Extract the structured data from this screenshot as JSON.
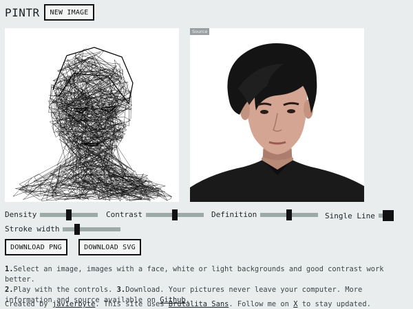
{
  "header": {
    "brand": "PINTR",
    "new_image_label": "NEW IMAGE"
  },
  "source_panel": {
    "badge": "Source"
  },
  "controls": {
    "density": {
      "label": "Density",
      "value": 0.5
    },
    "contrast": {
      "label": "Contrast",
      "value": 0.5
    },
    "definition": {
      "label": "Definition",
      "value": 0.5
    },
    "single_line": {
      "label": "Single Line",
      "checked": true
    },
    "stroke_width": {
      "label": "Stroke width",
      "value": 0.25
    }
  },
  "buttons": {
    "download_png": "DOWNLOAD PNG",
    "download_svg": "DOWNLOAD SVG"
  },
  "instructions": {
    "step1_num": "1.",
    "step1_text": "Select an image, images with a face, white or light backgrounds and good contrast work better.",
    "step2_num": "2.",
    "step2_text": "Play with the controls.",
    "step3_num": "3.",
    "step3_text": "Download. Your pictures never leave your computer. More information and source available on",
    "github_link": "Github",
    "end": "."
  },
  "footer": {
    "prefix": "Created by",
    "author_link": "javierbyte",
    "middle": ". This site uses",
    "font_link": "Brutalita Sans",
    "middle2": ". Follow me on",
    "x_link": "X",
    "suffix": "to stay updated."
  }
}
